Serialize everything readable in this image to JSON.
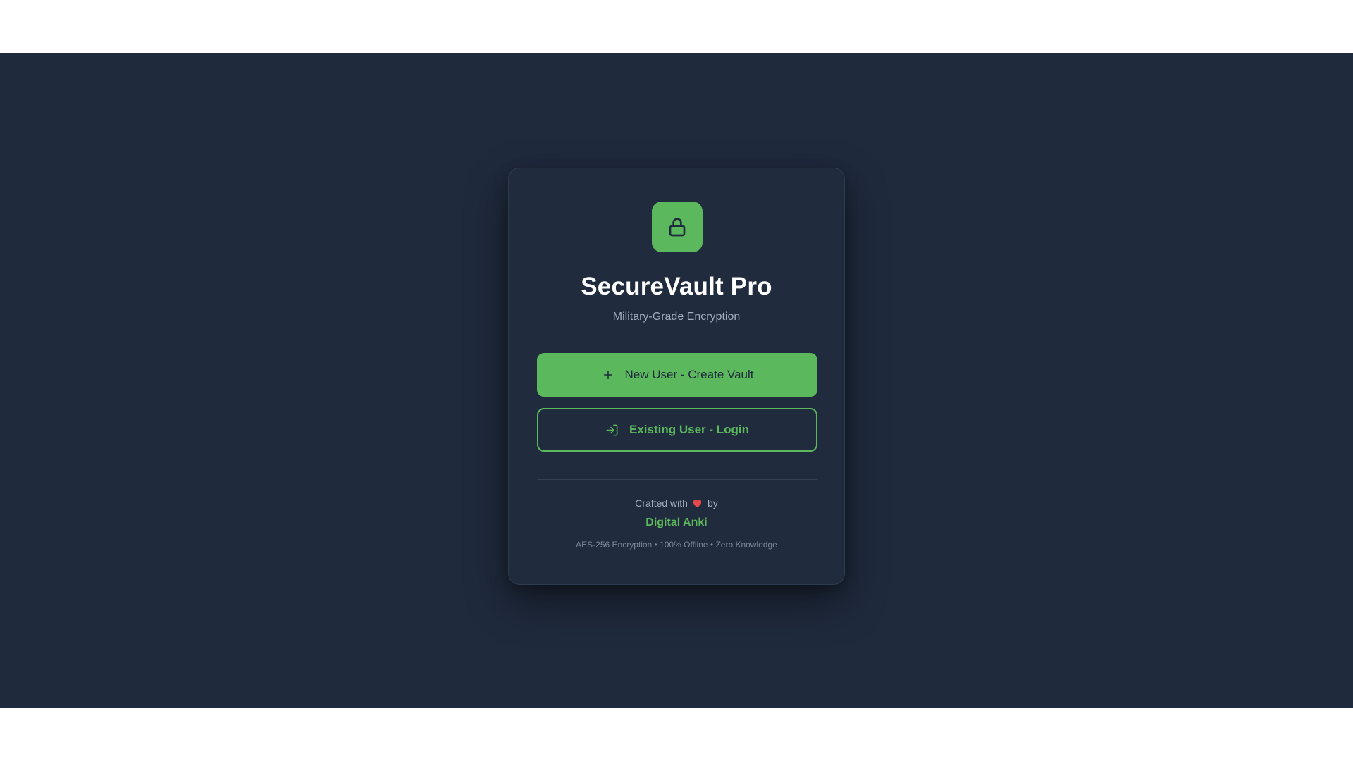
{
  "app": {
    "title": "SecureVault Pro",
    "subtitle": "Military-Grade Encryption",
    "logo_icon": "lock-icon"
  },
  "actions": {
    "create_label": "New User - Create Vault",
    "create_icon": "plus-icon",
    "login_label": "Existing User - Login",
    "login_icon": "login-arrow-icon"
  },
  "footer": {
    "crafted_prefix": "Crafted with",
    "crafted_icon": "heart-icon",
    "crafted_suffix": "by",
    "author": "Digital Anki",
    "features": "AES-256 Encryption • 100% Offline • Zero Knowledge"
  },
  "colors": {
    "background": "#1f2a3d",
    "card": "#202b3d",
    "accent": "#5cb85c",
    "heart": "#e5484d"
  }
}
